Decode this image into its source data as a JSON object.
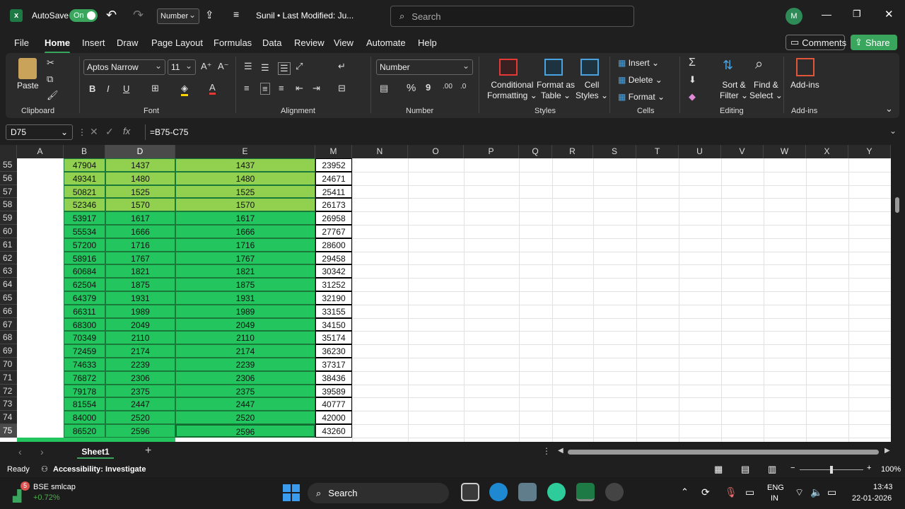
{
  "titlebar": {
    "autosave_label": "AutoSave",
    "autosave_state": "On",
    "format_dropdown": "Number",
    "doc_title": "Sunil • Last Modified: Ju...",
    "search_placeholder": "Search",
    "user_initial": "M"
  },
  "menu": {
    "items": [
      "File",
      "Home",
      "Insert",
      "Draw",
      "Page Layout",
      "Formulas",
      "Data",
      "Review",
      "View",
      "Automate",
      "Help"
    ],
    "comments_label": "Comments",
    "share_label": "Share"
  },
  "ribbon": {
    "clipboard": {
      "paste": "Paste",
      "label": "Clipboard"
    },
    "font": {
      "name": "Aptos Narrow",
      "size": "11",
      "label": "Font"
    },
    "alignment": {
      "label": "Alignment"
    },
    "number": {
      "format": "Number",
      "label": "Number"
    },
    "styles": {
      "conditional": "Conditional",
      "formatting": "Formatting",
      "format_as": "Format as",
      "table": "Table",
      "cell": "Cell",
      "cell_styles": "Styles",
      "label": "Styles"
    },
    "cells": {
      "insert": "Insert",
      "delete": "Delete",
      "format": "Format",
      "label": "Cells"
    },
    "editing": {
      "sort": "Sort &",
      "filter": "Filter",
      "find": "Find &",
      "select": "Select",
      "label": "Editing"
    },
    "addins": {
      "btn": "Add-ins",
      "label": "Add-ins"
    }
  },
  "formula_bar": {
    "name_box": "D75",
    "formula": "=B75-C75"
  },
  "grid": {
    "columns": [
      "A",
      "B",
      "D",
      "E",
      "M",
      "N",
      "O",
      "P",
      "Q",
      "R",
      "S",
      "T",
      "U",
      "V",
      "W",
      "X",
      "Y"
    ],
    "rows": [
      {
        "n": "55",
        "a": "47904",
        "b": "1437",
        "d": "1437",
        "e": "23952"
      },
      {
        "n": "56",
        "a": "49341",
        "b": "1480",
        "d": "1480",
        "e": "24671"
      },
      {
        "n": "57",
        "a": "50821",
        "b": "1525",
        "d": "1525",
        "e": "25411"
      },
      {
        "n": "58",
        "a": "52346",
        "b": "1570",
        "d": "1570",
        "e": "26173"
      },
      {
        "n": "59",
        "a": "53917",
        "b": "1617",
        "d": "1617",
        "e": "26958"
      },
      {
        "n": "60",
        "a": "55534",
        "b": "1666",
        "d": "1666",
        "e": "27767"
      },
      {
        "n": "61",
        "a": "57200",
        "b": "1716",
        "d": "1716",
        "e": "28600"
      },
      {
        "n": "62",
        "a": "58916",
        "b": "1767",
        "d": "1767",
        "e": "29458"
      },
      {
        "n": "63",
        "a": "60684",
        "b": "1821",
        "d": "1821",
        "e": "30342"
      },
      {
        "n": "64",
        "a": "62504",
        "b": "1875",
        "d": "1875",
        "e": "31252"
      },
      {
        "n": "65",
        "a": "64379",
        "b": "1931",
        "d": "1931",
        "e": "32190"
      },
      {
        "n": "66",
        "a": "66311",
        "b": "1989",
        "d": "1989",
        "e": "33155"
      },
      {
        "n": "67",
        "a": "68300",
        "b": "2049",
        "d": "2049",
        "e": "34150"
      },
      {
        "n": "68",
        "a": "70349",
        "b": "2110",
        "d": "2110",
        "e": "35174"
      },
      {
        "n": "69",
        "a": "72459",
        "b": "2174",
        "d": "2174",
        "e": "36230"
      },
      {
        "n": "70",
        "a": "74633",
        "b": "2239",
        "d": "2239",
        "e": "37317"
      },
      {
        "n": "71",
        "a": "76872",
        "b": "2306",
        "d": "2306",
        "e": "38436"
      },
      {
        "n": "72",
        "a": "79178",
        "b": "2375",
        "d": "2375",
        "e": "39589"
      },
      {
        "n": "73",
        "a": "81554",
        "b": "2447",
        "d": "2447",
        "e": "40777"
      },
      {
        "n": "74",
        "a": "84000",
        "b": "2520",
        "d": "2520",
        "e": "42000"
      },
      {
        "n": "75",
        "a": "86520",
        "b": "2596",
        "d": "2596",
        "e": "43260"
      }
    ],
    "light_green": "#92d050",
    "green": "#22c55e"
  },
  "sheets": {
    "active": "Sheet1"
  },
  "status": {
    "ready": "Ready",
    "accessibility": "Accessibility: Investigate",
    "zoom": "100%"
  },
  "taskbar": {
    "stock_badge": "5",
    "stock_name": "BSE smlcap",
    "stock_change": "+0.72%",
    "search": "Search",
    "lang1": "ENG",
    "lang2": "IN",
    "time": "13:43",
    "date": "22-01-2026"
  }
}
